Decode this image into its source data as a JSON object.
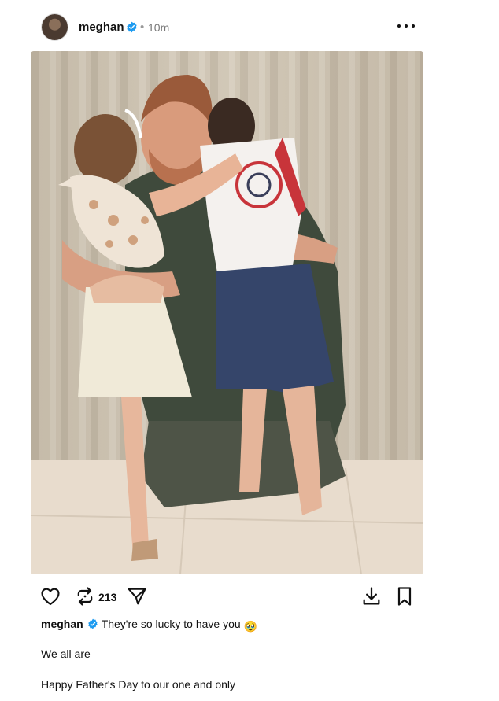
{
  "post": {
    "username": "meghan",
    "separator": "•",
    "timestamp": "10m",
    "image_alt": "Photo of a man kneeling and hugging two young children"
  },
  "actions": {
    "repost_count": "213"
  },
  "caption": {
    "username": "meghan",
    "text": "They're so lucky to have you",
    "emoji": "🥹",
    "line2": "We all are",
    "line3": "Happy Father's Day to our one and only"
  },
  "colors": {
    "verified": "#1d9bf0",
    "text": "#111111",
    "muted": "#777777"
  }
}
